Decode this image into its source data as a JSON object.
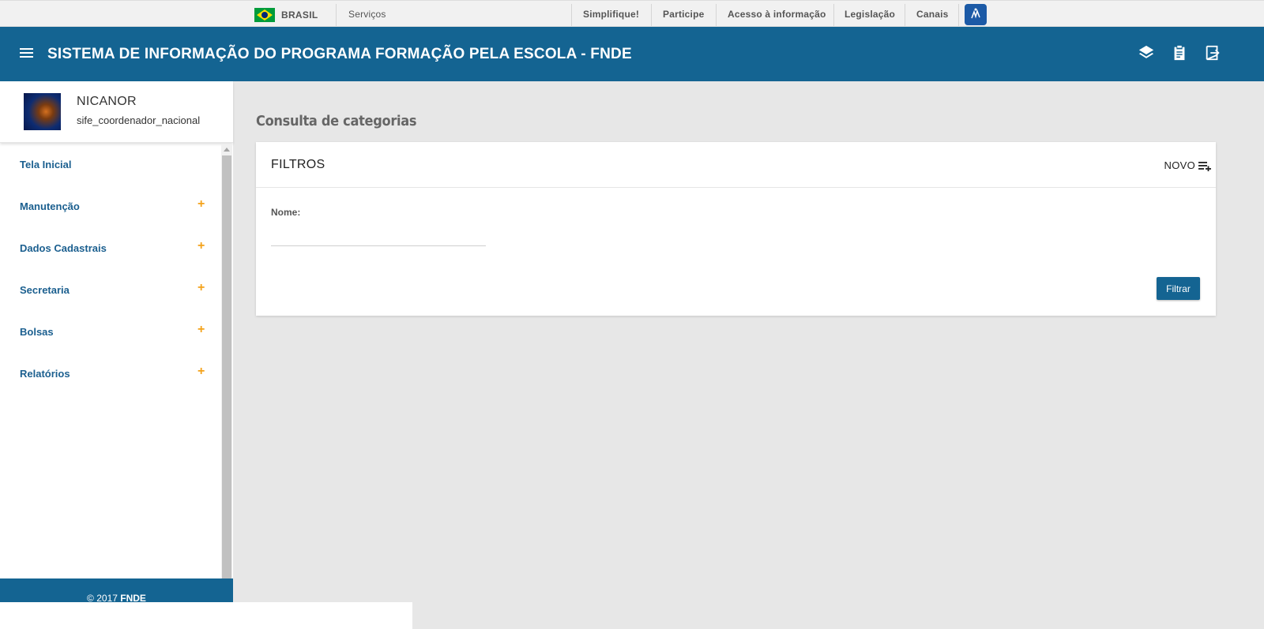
{
  "govbar": {
    "brasil": "BRASIL",
    "servicos": "Serviços",
    "links": [
      "Simplifique!",
      "Participe",
      "Acesso à informação",
      "Legislação",
      "Canais"
    ]
  },
  "header": {
    "title": "SISTEMA DE INFORMAÇÃO DO PROGRAMA FORMAÇÃO PELA ESCOLA - FNDE"
  },
  "user": {
    "name": "NICANOR",
    "role": "sife_coordenador_nacional"
  },
  "sidebar": {
    "items": [
      {
        "label": "Tela Inicial",
        "expandable": false
      },
      {
        "label": "Manutenção",
        "expandable": true
      },
      {
        "label": "Dados Cadastrais",
        "expandable": true
      },
      {
        "label": "Secretaria",
        "expandable": true
      },
      {
        "label": "Bolsas",
        "expandable": true
      },
      {
        "label": "Relatórios",
        "expandable": true
      }
    ],
    "plus": "+"
  },
  "footer": {
    "copyright": "© 2017 ",
    "org": "FNDE"
  },
  "main": {
    "page_title": "Consulta de categorias",
    "filters_title": "FILTROS",
    "novo_label": "NOVO",
    "nome_label": "Nome:",
    "nome_value": "",
    "filtrar_label": "Filtrar"
  },
  "colors": {
    "primary": "#146492",
    "accent": "#f4a21a"
  }
}
